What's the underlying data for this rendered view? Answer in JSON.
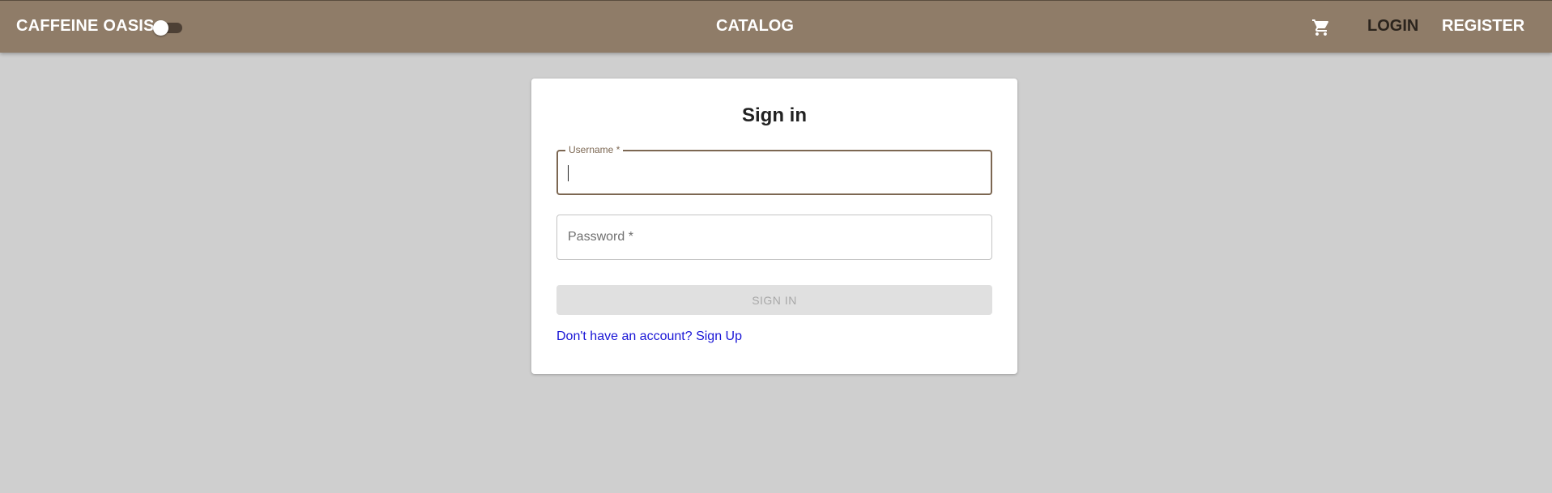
{
  "header": {
    "brand": "CAFFEINE OASIS",
    "theme_toggle": {
      "checked": false
    },
    "catalog_label": "CATALOG",
    "cart_icon": "shopping-cart-icon",
    "login_label": "LOGIN",
    "register_label": "REGISTER"
  },
  "signin": {
    "title": "Sign in",
    "username": {
      "label": "Username *",
      "value": ""
    },
    "password": {
      "placeholder": "Password *",
      "value": ""
    },
    "submit_label": "SIGN IN",
    "signup_link": "Don't have an account? Sign Up"
  },
  "colors": {
    "appbar": "#8f7c68",
    "background": "#cfcfcf",
    "accent": "#7c6752",
    "link": "#1a16d6"
  }
}
